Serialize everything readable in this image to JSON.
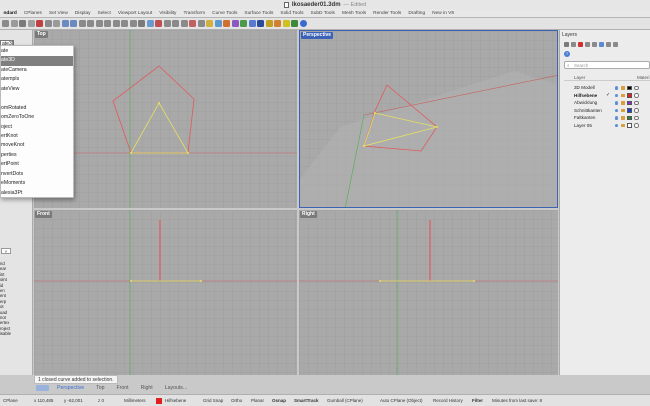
{
  "window": {
    "file_name": "Ikosaeder01.3dm",
    "edited_label": "— Edited"
  },
  "tabs": [
    "ndard",
    "CPlanes",
    "Set View",
    "Display",
    "Select",
    "Viewport Layout",
    "Visibility",
    "Transform",
    "Curve Tools",
    "Surface Tools",
    "Solid Tools",
    "SubD Tools",
    "Mesh Tools",
    "Render Tools",
    "Drafting",
    "New in V8"
  ],
  "command": {
    "input_value": "ate3D"
  },
  "command_menu": {
    "items": [
      "ate",
      "ate3D",
      "ateCamera",
      "atempls",
      "ateView",
      "",
      "omRotated",
      "omZeroToOne",
      "oject",
      "ertKnot",
      "moveKnot",
      "perties",
      "ertPoint",
      "nvertDots",
      "eMoments",
      "alesia3Pt"
    ],
    "selected_index": 1
  },
  "left_panel": {
    "filter_label": "Y",
    "osnap_items": [
      "nd",
      "ear",
      "int",
      "oint",
      "id",
      "en",
      "ent",
      "erp",
      "ot",
      "uad",
      "not",
      "ertex",
      "roject",
      "",
      "isable"
    ]
  },
  "viewports": {
    "top": {
      "label": "Top"
    },
    "perspective": {
      "label": "Perspective"
    },
    "front": {
      "label": "Front"
    },
    "right": {
      "label": "Right"
    }
  },
  "layers_panel": {
    "title": "Layers",
    "search_placeholder": "Search",
    "col_layer": "Layer",
    "col_material": "Materi",
    "help_label": "?",
    "layers": [
      {
        "name": "3D Modell",
        "current": false,
        "color": "#000000"
      },
      {
        "name": "Hilfsebene",
        "current": true,
        "color": "#e02020"
      },
      {
        "name": "Abwicklung",
        "current": false,
        "color": "#8a2be2"
      },
      {
        "name": "Schnittkanten",
        "current": false,
        "color": "#1f3fd0"
      },
      {
        "name": "Faltkanten",
        "current": false,
        "color": "#1e8a2a"
      },
      {
        "name": "Layer 05",
        "current": false,
        "color": "#ffffff"
      }
    ]
  },
  "view_tabs": [
    "Perspective",
    "Top",
    "Front",
    "Right",
    "Layouts..."
  ],
  "view_tabs_active": 0,
  "command_history": "1 closed curve added to selection.",
  "status_bar": {
    "cplane": "CPlane",
    "x": "x 110,485",
    "y": "y -62,001",
    "z": "z 0",
    "units": "Millimeters",
    "layer": "Hilfsebene",
    "grid_snap": "Grid Snap",
    "ortho": "Ortho",
    "planar": "Planar",
    "osnap": "Osnap",
    "smarttrack": "SmartTrack",
    "gumball": "Gumball (CPlane)",
    "auto_cplane": "Auto CPlane (Object)",
    "record_history": "Record History",
    "filter": "Filter",
    "minutes": "Minutes from last save: 8"
  },
  "colors": {
    "active_viewport": "#3b63b8",
    "curve_red": "#e05a5a",
    "curve_yellow": "#e8e060",
    "axis_green": "#4caf50"
  }
}
